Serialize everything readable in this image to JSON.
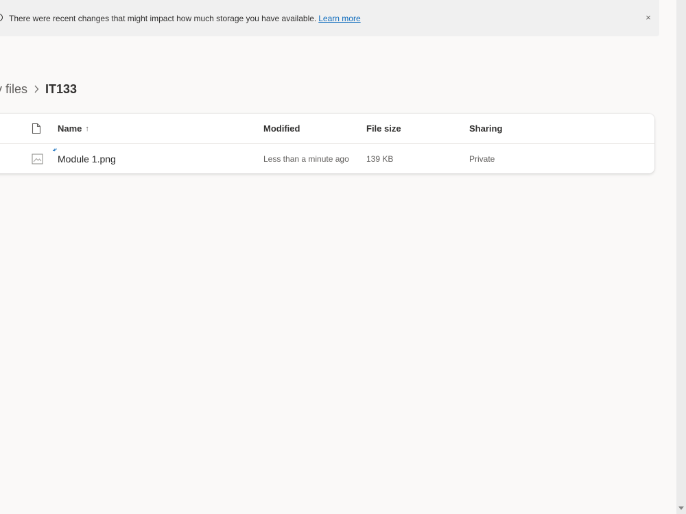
{
  "banner": {
    "message": "There were recent changes that might impact how much storage you have available.",
    "link_text": "Learn more",
    "close_icon": "×"
  },
  "breadcrumb": {
    "parent": "y files",
    "separator": "chevron-right-icon",
    "current": "IT133"
  },
  "file_list": {
    "columns": {
      "name": "Name",
      "modified": "Modified",
      "file_size": "File size",
      "sharing": "Sharing"
    },
    "sort_indicator": "↑",
    "rows": [
      {
        "name": "Module 1.png",
        "modified": "Less than a minute ago",
        "file_size": "139 KB",
        "sharing": "Private",
        "icon": "image-file-icon"
      }
    ]
  },
  "colors": {
    "link": "#0f6cbd",
    "background": "#faf9f8",
    "banner": "#f0f0f0",
    "sync_indicator": "#0f6cbd"
  }
}
